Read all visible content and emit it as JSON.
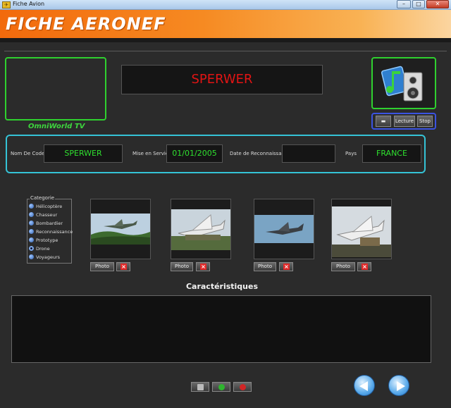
{
  "window": {
    "title": "Fiche Avion",
    "minimize": "–",
    "maximize": "□",
    "close": "✕"
  },
  "header": {
    "title": "FICHE AERONEF"
  },
  "aircraft": {
    "name": "SPERWER"
  },
  "brand": {
    "logo_text": "OmniWorld TV"
  },
  "media": {
    "eject_label": "▬",
    "play_label": "Lecture",
    "stop_label": "Stop"
  },
  "fields": {
    "code": {
      "label": "Nom De Code",
      "value": "SPERWER"
    },
    "service": {
      "label": "Mise en Service",
      "value": "01/01/2005"
    },
    "recognition": {
      "label": "Date de Reconnaissance",
      "value": ""
    },
    "country": {
      "label": "Pays",
      "value": "FRANCE"
    }
  },
  "category": {
    "title": "Categorie",
    "options": [
      {
        "label": "Hélicoptère",
        "checked": false
      },
      {
        "label": "Chasseur",
        "checked": false
      },
      {
        "label": "Bombardier",
        "checked": false
      },
      {
        "label": "Reconnaissance",
        "checked": false
      },
      {
        "label": "Prototype",
        "checked": false
      },
      {
        "label": "Drone",
        "checked": true
      },
      {
        "label": "Voyageurs",
        "checked": false
      }
    ]
  },
  "photos": {
    "button_label": "Photo"
  },
  "characteristics": {
    "title": "Caractéristiques",
    "text": ""
  },
  "colors": {
    "accent_orange": "#f26a0c",
    "frame_green": "#2fd12f",
    "frame_cyan": "#35c3d6",
    "value_green": "#2fe02f",
    "name_red": "#e11414"
  }
}
